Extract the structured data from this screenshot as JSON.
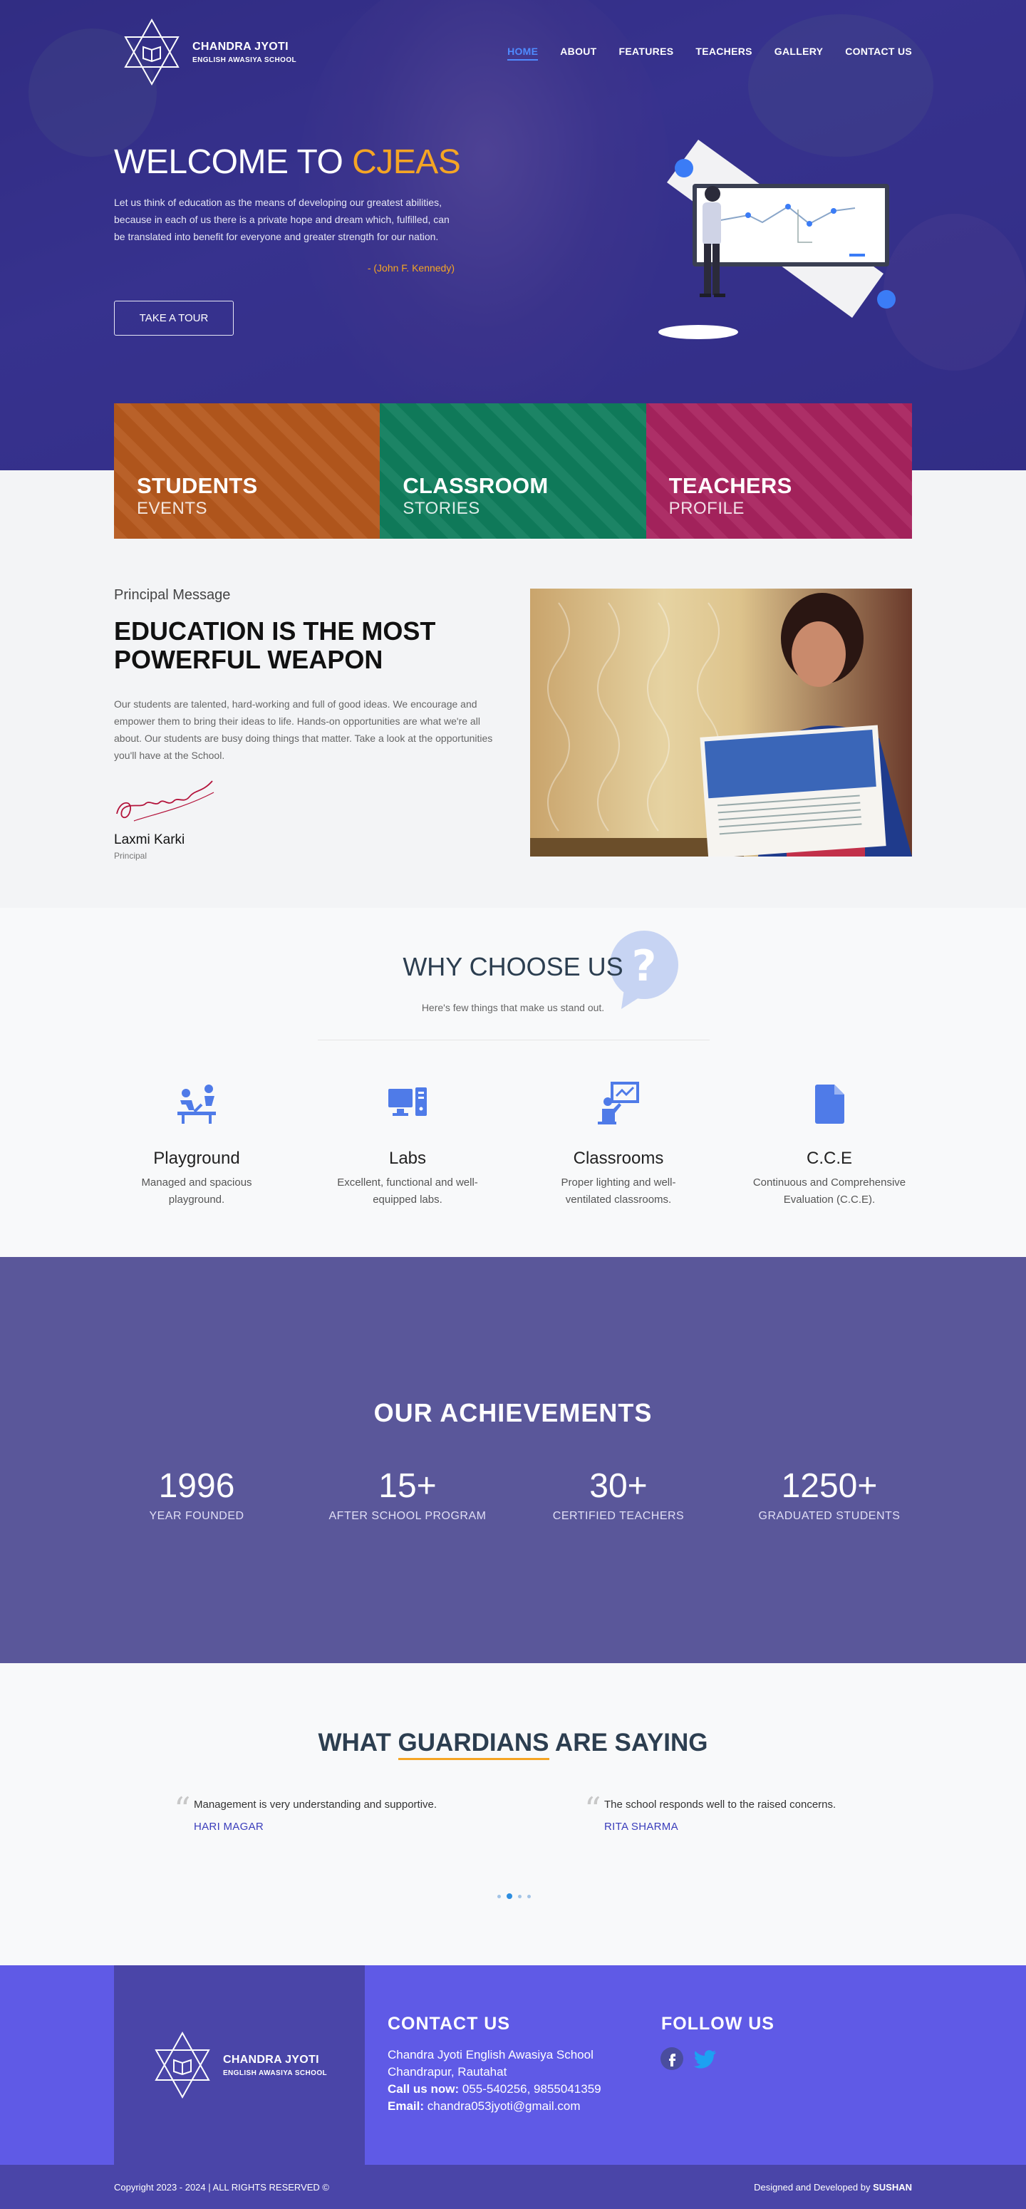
{
  "brand": {
    "name": "CHANDRA JYOTI",
    "sub": "ENGLISH AWASIYA SCHOOL"
  },
  "nav": [
    {
      "label": "HOME",
      "active": true
    },
    {
      "label": "ABOUT"
    },
    {
      "label": "FEATURES"
    },
    {
      "label": "TEACHERS"
    },
    {
      "label": "GALLERY"
    },
    {
      "label": "CONTACT US"
    }
  ],
  "hero": {
    "title_prefix": "WELCOME TO ",
    "title_accent": "CJEAS",
    "quote": "Let us think of education as the means of developing our greatest abilities, because in each of us there is a private hope and dream which, fulfilled, can be translated into benefit for everyone and greater strength for our nation.",
    "author": "- (John F. Kennedy)",
    "button": "TAKE A TOUR"
  },
  "cards": [
    {
      "title": "STUDENTS",
      "sub": "EVENTS",
      "color": "#b5581d"
    },
    {
      "title": "CLASSROOM",
      "sub": "STORIES",
      "color": "#0f7d5c"
    },
    {
      "title": "TEACHERS",
      "sub": "PROFILE",
      "color": "#a8235e"
    }
  ],
  "principal": {
    "label": "Principal Message",
    "title": "EDUCATION IS THE MOST POWERFUL WEAPON",
    "body": "Our students are talented, hard-working and full of good ideas. We encourage and empower them to bring their ideas to life. Hands-on opportunities are what we're all about. Our students are busy doing things that matter. Take a look at the opportunities you'll have at the School.",
    "name": "Laxmi Karki",
    "role": "Principal"
  },
  "why": {
    "title": "WHY CHOOSE US",
    "subtitle": "Here's few things that make us stand out.",
    "features": [
      {
        "icon": "playground-icon",
        "title": "Playground",
        "desc": "Managed and spacious playground."
      },
      {
        "icon": "computer-lab-icon",
        "title": "Labs",
        "desc": "Excellent, functional and well-equipped labs."
      },
      {
        "icon": "classroom-icon",
        "title": "Classrooms",
        "desc": "Proper lighting and well-ventilated classrooms."
      },
      {
        "icon": "document-icon",
        "title": "C.C.E",
        "desc": "Continuous and Comprehensive Evaluation (C.C.E)."
      }
    ]
  },
  "achievements": {
    "title": "OUR ACHIEVEMENTS",
    "stats": [
      {
        "value": "1996",
        "label": "YEAR FOUNDED"
      },
      {
        "value": "15+",
        "label": "AFTER SCHOOL PROGRAM"
      },
      {
        "value": "30+",
        "label": "CERTIFIED TEACHERS"
      },
      {
        "value": "1250+",
        "label": "GRADUATED STUDENTS"
      }
    ]
  },
  "testimonials": {
    "title_prefix": "WHAT ",
    "title_underlined": "GUARDIANS",
    "title_suffix": " ARE SAYING",
    "items": [
      {
        "text": "Management is very understanding and supportive.",
        "author": "HARI MAGAR"
      },
      {
        "text": "The school responds well to the raised concerns.",
        "author": "RITA SHARMA"
      }
    ]
  },
  "footer": {
    "contact_title": "CONTACT US",
    "school": "Chandra Jyoti English Awasiya School",
    "address": "Chandrapur, Rautahat",
    "call_label": "Call us now:",
    "phone": "055-540256, 9855041359",
    "email_label": "Email:",
    "email": "chandra053jyoti@gmail.com",
    "follow_title": "FOLLOW US",
    "copyright": "Copyright 2023 - 2024 | ALL RIGHTS RESERVED ©",
    "credits_prefix": "Designed and Developed by ",
    "credits_name": "SUSHAN"
  },
  "colors": {
    "accent": "#f5a524",
    "primary": "#5f5ae6",
    "nav_active": "#4f8bff"
  }
}
